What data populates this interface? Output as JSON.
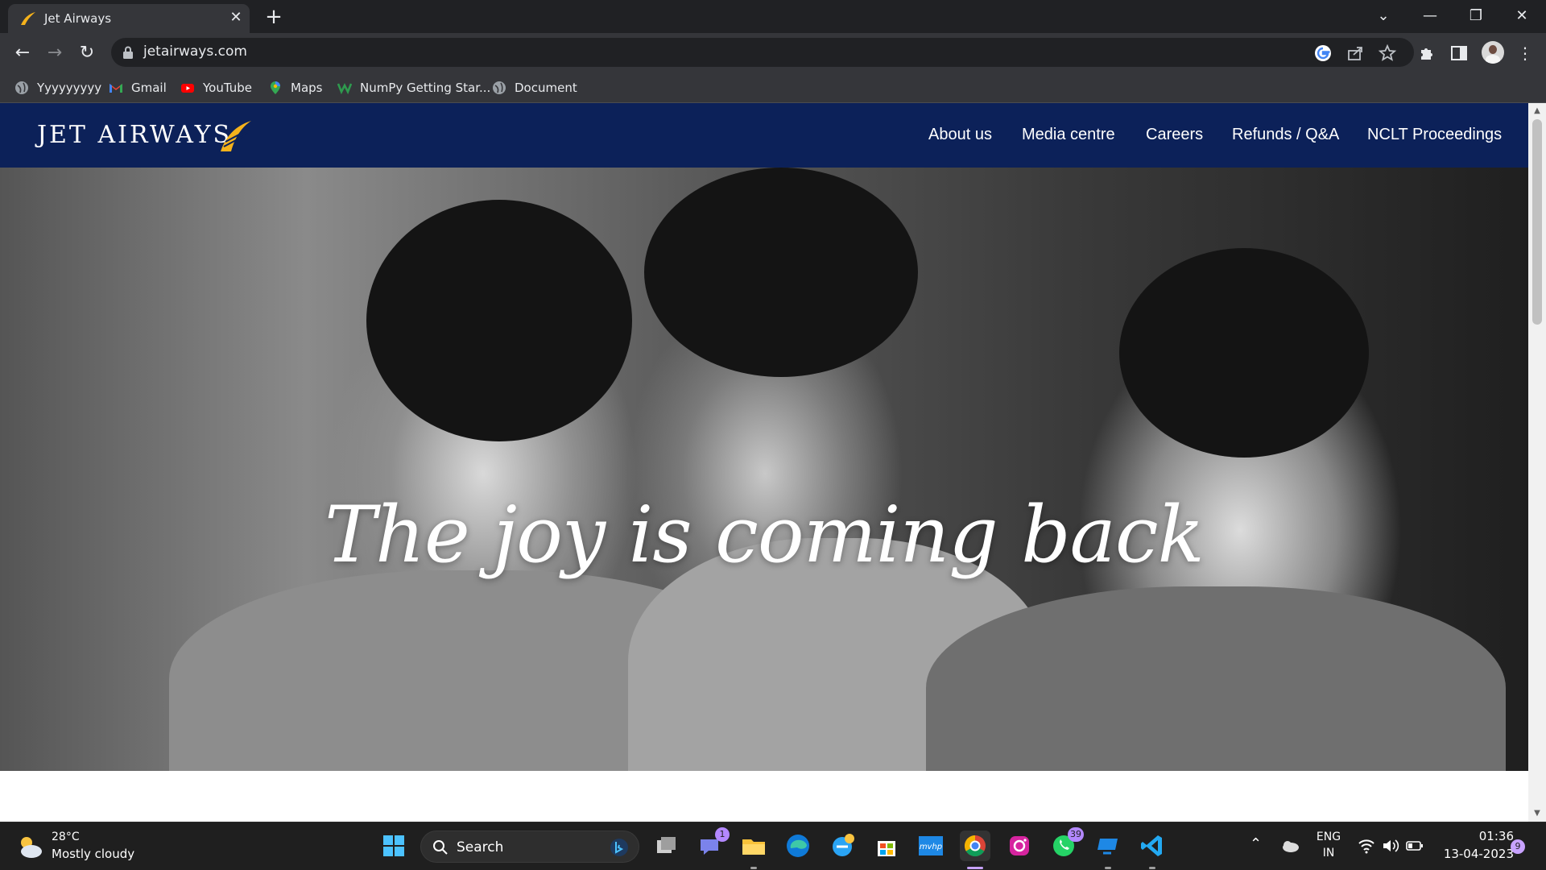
{
  "browser": {
    "tab_title": "Jet Airways",
    "url": "jetairways.com",
    "bookmarks": [
      {
        "label": "Yyyyyyyyy",
        "icon": "globe-icon"
      },
      {
        "label": "Gmail",
        "icon": "gmail-icon"
      },
      {
        "label": "YouTube",
        "icon": "youtube-icon"
      },
      {
        "label": "Maps",
        "icon": "maps-icon"
      },
      {
        "label": "NumPy Getting Star...",
        "icon": "numpy-icon"
      },
      {
        "label": "Document",
        "icon": "globe-icon"
      }
    ]
  },
  "site": {
    "logo_text": "JET AIRWAYS",
    "nav": [
      "About us",
      "Media centre",
      "Careers",
      "Refunds / Q&A",
      "NCLT Proceedings"
    ],
    "hero_tagline": "The joy is coming back",
    "colors": {
      "header": "#0c2159",
      "logo_mark": "#f5b21b"
    }
  },
  "taskbar": {
    "weather_temp": "28°C",
    "weather_desc": "Mostly cloudy",
    "search_label": "Search",
    "teams_badge": "1",
    "whatsapp_badge": "39",
    "lang_line1": "ENG",
    "lang_line2": "IN",
    "time": "01:36",
    "date": "13-04-2023",
    "notification_count": "9"
  }
}
